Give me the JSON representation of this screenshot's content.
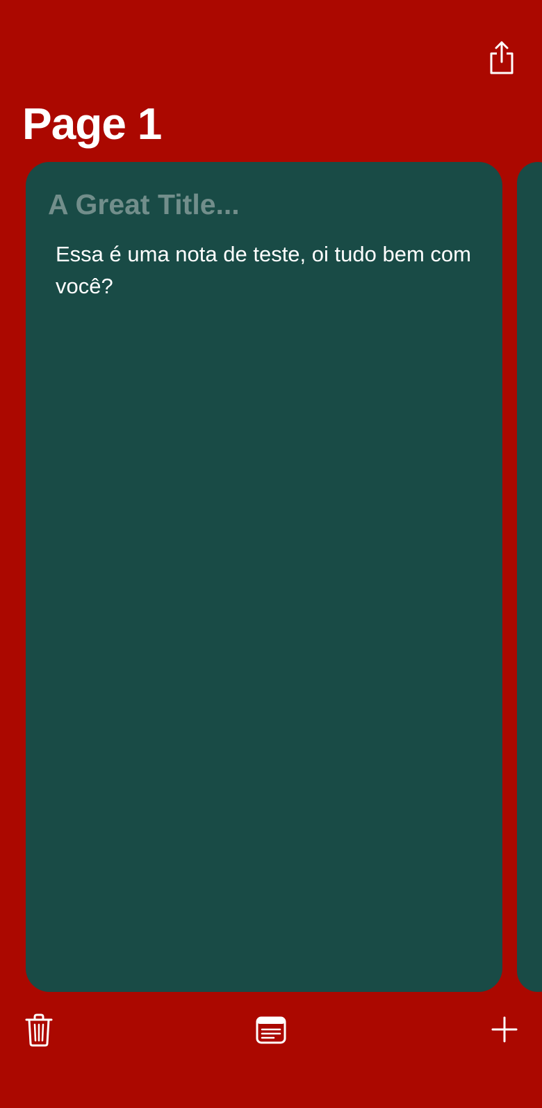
{
  "header": {
    "title": "Page 1",
    "share_icon": "share-icon"
  },
  "note": {
    "title_placeholder": "A Great Title...",
    "body": "Essa é uma nota de teste, oi tudo bem com você?"
  },
  "toolbar": {
    "delete_icon": "trash-icon",
    "notes_icon": "notes-list-icon",
    "add_icon": "plus-icon"
  },
  "colors": {
    "background": "#ab0800",
    "card": "#194b46",
    "title_placeholder": "#728e8b",
    "text": "#ffffff"
  }
}
